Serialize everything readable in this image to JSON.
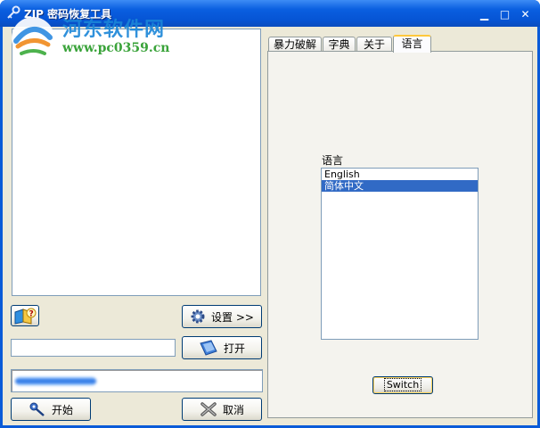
{
  "window": {
    "title": "ZIP 密码恢复工具",
    "titlebar_color": "#0a5fe0",
    "controls": {
      "minimize": "▁",
      "maximize": "□",
      "close": "✕"
    }
  },
  "watermark": {
    "name": "河东软件网",
    "url": "www.pc0359.cn"
  },
  "left": {
    "help_icon": "book-question-icon",
    "settings_label": "设置 >>",
    "open_label": "打开",
    "file_path_value": "",
    "progress_fraction": 0.33,
    "start_label": "开始",
    "cancel_label": "取消"
  },
  "tabs": [
    {
      "label": "暴力破解",
      "active": false
    },
    {
      "label": "字典",
      "active": false
    },
    {
      "label": "关于",
      "active": false
    },
    {
      "label": "语言",
      "active": true
    }
  ],
  "language_panel": {
    "label": "语言",
    "options": [
      {
        "text": "English",
        "selected": false
      },
      {
        "text": "简体中文",
        "selected": true
      }
    ],
    "switch_label": "Switch"
  },
  "colors": {
    "accent": "#316ac5",
    "tab_highlight": "#ffc83c"
  }
}
